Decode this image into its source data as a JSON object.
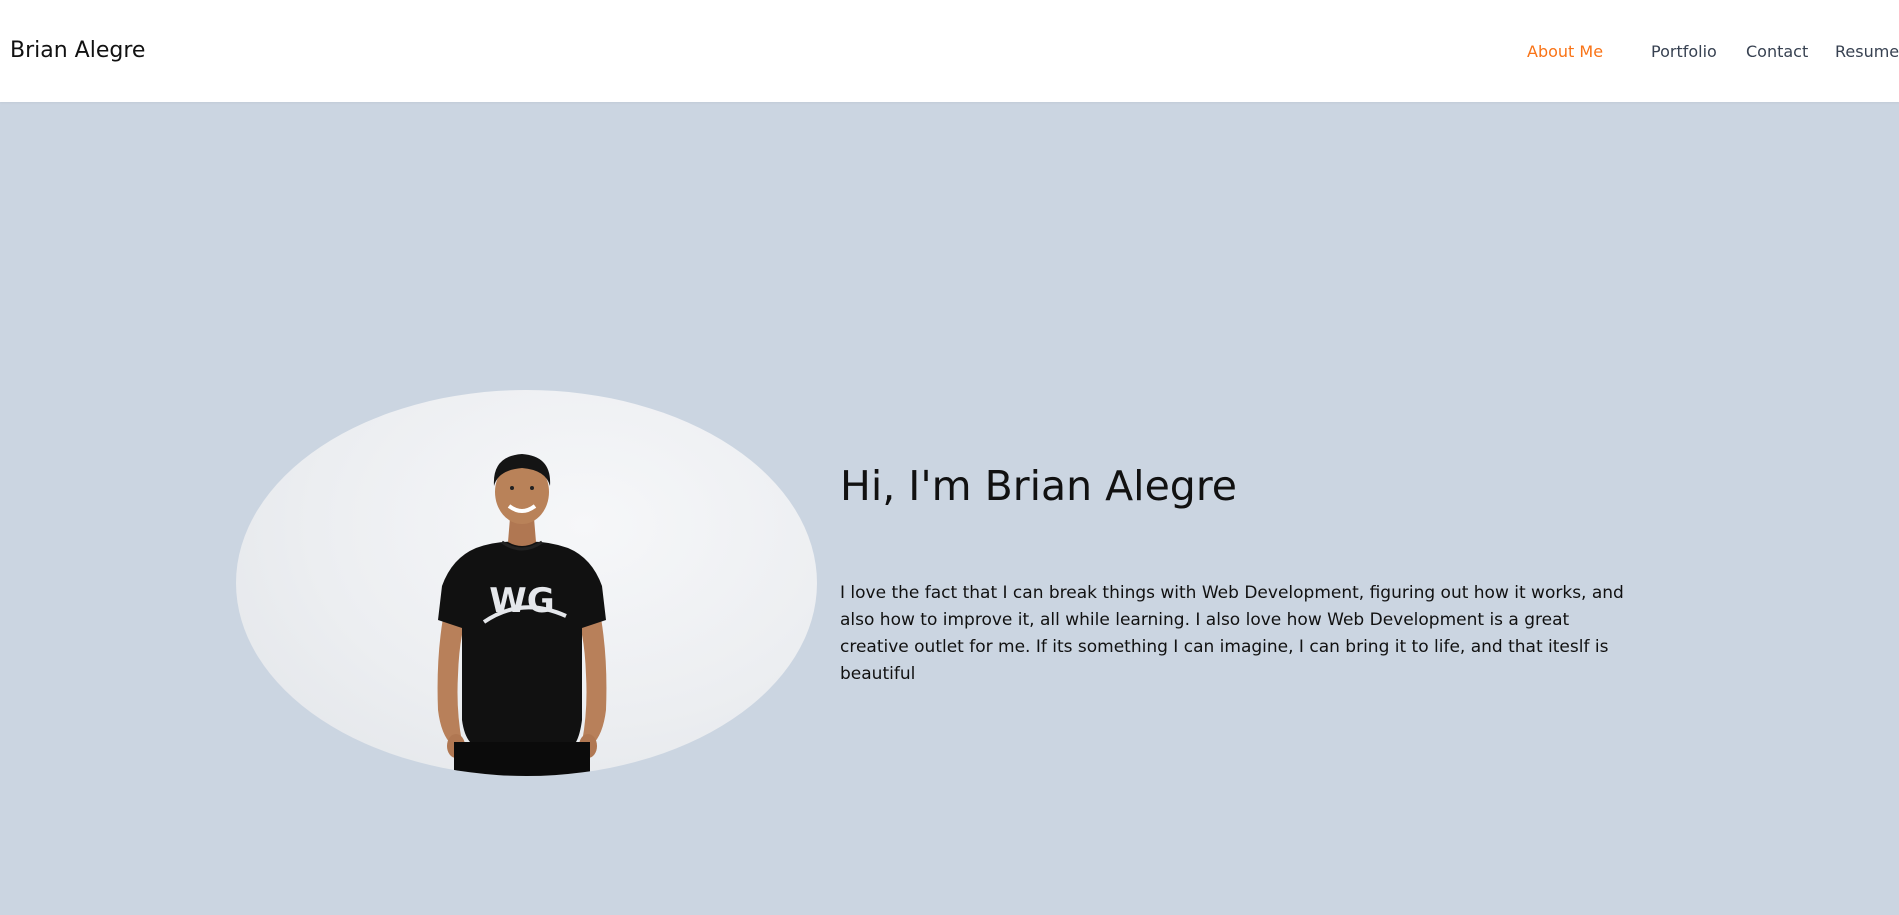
{
  "header": {
    "brand": "Brian Alegre",
    "nav": [
      {
        "label": "About Me",
        "active": true
      },
      {
        "label": "Portfolio",
        "active": false
      },
      {
        "label": "Contact",
        "active": false
      },
      {
        "label": "Resume",
        "active": false
      }
    ]
  },
  "hero": {
    "title": "Hi, I'm Brian Alegre",
    "body": "I love the fact that I can break things with Web Development, figuring out how it works, and also how to improve it, all while learning. I also love how Web Development is a great creative outlet for me. If its something I can imagine, I can bring it to life, and that iteslf is beautiful",
    "photo_shirt_logo": "WG"
  },
  "colors": {
    "background": "#cbd5e1",
    "header": "#ffffff",
    "accent": "#f97316",
    "text": "#111111"
  }
}
